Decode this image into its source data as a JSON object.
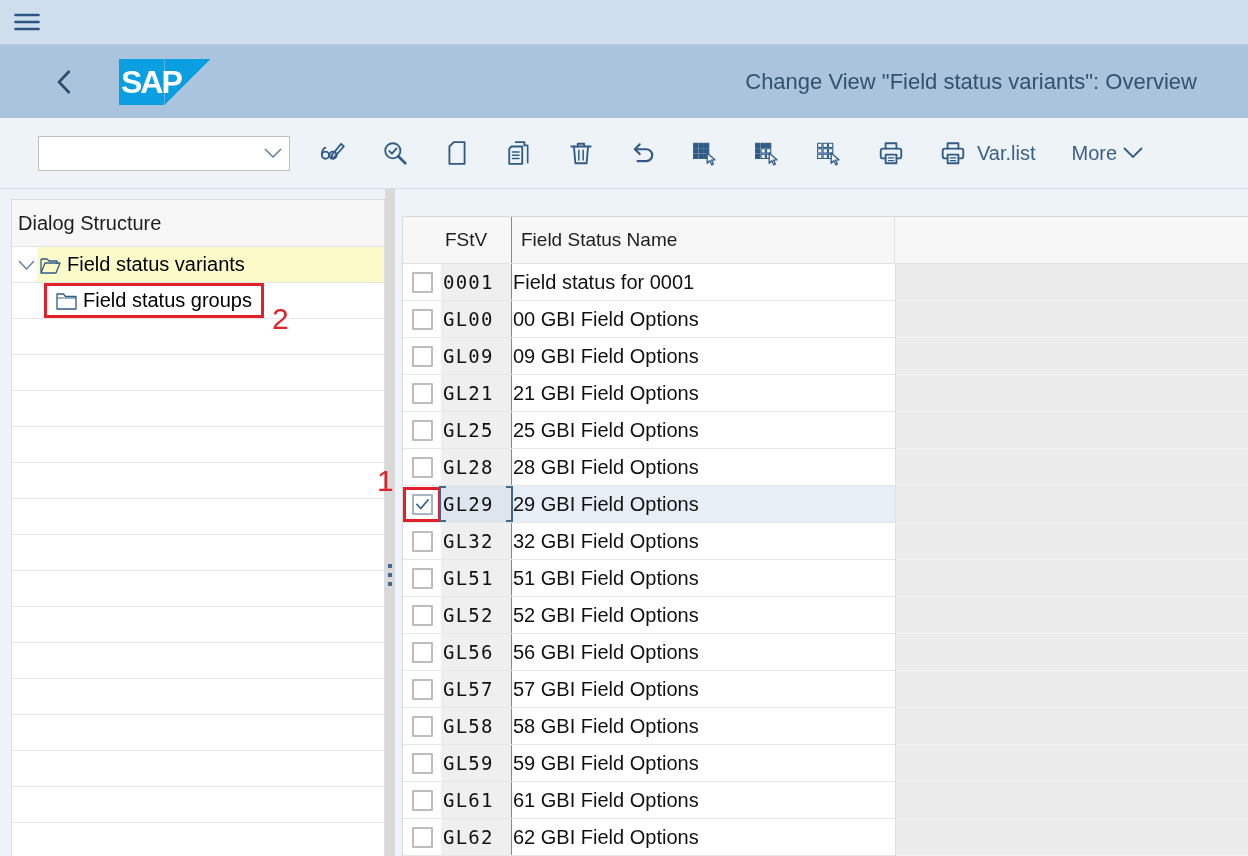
{
  "header": {
    "logo": "SAP",
    "title": "Change View \"Field status variants\": Overview"
  },
  "toolbar": {
    "buttons": [
      {
        "kind": "display"
      },
      {
        "kind": "check"
      },
      {
        "kind": "new"
      },
      {
        "kind": "copy"
      },
      {
        "kind": "delete"
      },
      {
        "kind": "undo"
      },
      {
        "kind": "selectall"
      },
      {
        "kind": "selectblock"
      },
      {
        "kind": "deselectall"
      },
      {
        "kind": "print"
      },
      {
        "kind": "print",
        "label": "Var.list"
      },
      {
        "kind": "menu",
        "label": "More"
      }
    ]
  },
  "dialog_structure": {
    "title": "Dialog Structure",
    "items": [
      {
        "label": "Field status variants",
        "expanded": true,
        "selected": true,
        "children": [
          {
            "label": "Field status groups",
            "expanded": false,
            "selected": false,
            "callout": "2"
          }
        ]
      }
    ]
  },
  "table": {
    "columns": [
      {
        "label": "FStV"
      },
      {
        "label": "Field Status Name"
      }
    ],
    "rows": [
      {
        "key": "0001",
        "name": "Field status for 0001",
        "checked": false,
        "selected": false
      },
      {
        "key": "GL00",
        "name": "00 GBI Field Options",
        "checked": false,
        "selected": false
      },
      {
        "key": "GL09",
        "name": "09 GBI Field Options",
        "checked": false,
        "selected": false
      },
      {
        "key": "GL21",
        "name": "21 GBI Field Options",
        "checked": false,
        "selected": false
      },
      {
        "key": "GL25",
        "name": "25 GBI Field Options",
        "checked": false,
        "selected": false
      },
      {
        "key": "GL28",
        "name": "28 GBI Field Options",
        "checked": false,
        "selected": false
      },
      {
        "key": "GL29",
        "name": "29 GBI Field Options",
        "checked": true,
        "selected": true,
        "callout": "1"
      },
      {
        "key": "GL32",
        "name": "32 GBI Field Options",
        "checked": false,
        "selected": false
      },
      {
        "key": "GL51",
        "name": "51 GBI Field Options",
        "checked": false,
        "selected": false
      },
      {
        "key": "GL52",
        "name": "52 GBI Field Options",
        "checked": false,
        "selected": false
      },
      {
        "key": "GL56",
        "name": "56 GBI Field Options",
        "checked": false,
        "selected": false
      },
      {
        "key": "GL57",
        "name": "57 GBI Field Options",
        "checked": false,
        "selected": false
      },
      {
        "key": "GL58",
        "name": "58 GBI Field Options",
        "checked": false,
        "selected": false
      },
      {
        "key": "GL59",
        "name": "59 GBI Field Options",
        "checked": false,
        "selected": false
      },
      {
        "key": "GL61",
        "name": "61 GBI Field Options",
        "checked": false,
        "selected": false
      },
      {
        "key": "GL62",
        "name": "62 GBI Field Options",
        "checked": false,
        "selected": false
      }
    ]
  }
}
